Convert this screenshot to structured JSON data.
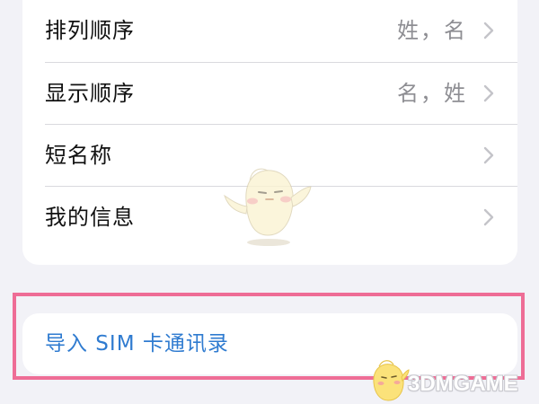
{
  "settings": {
    "rows": [
      {
        "label": "排列顺序",
        "value": "姓，名"
      },
      {
        "label": "显示顺序",
        "value": "名，姓"
      },
      {
        "label": "短名称",
        "value": ""
      },
      {
        "label": "我的信息",
        "value": ""
      }
    ],
    "import_sim": {
      "label": "导入 SIM 卡通讯录"
    }
  },
  "watermark": {
    "text": "3DMGAME"
  },
  "colors": {
    "accent": "#2f7bd0",
    "highlight": "#ee6d96",
    "background": "#f2f2f7"
  },
  "icons": {
    "chevron": "chevron-right-icon"
  }
}
